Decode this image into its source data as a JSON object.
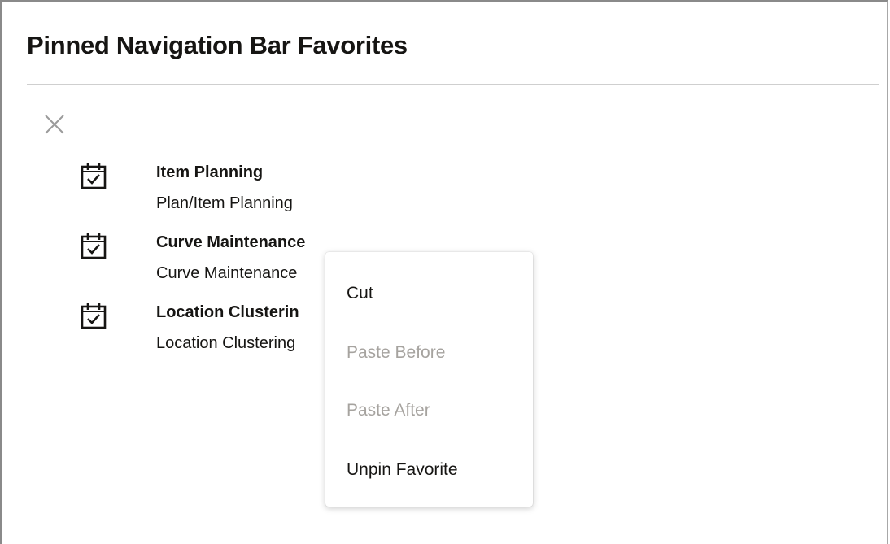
{
  "dialog": {
    "title": "Pinned Navigation Bar Favorites"
  },
  "toolbar": {
    "close_icon": "close-icon"
  },
  "favorites": [
    {
      "name": "Item Planning",
      "path": "Plan/Item Planning",
      "icon": "calendar-check-icon"
    },
    {
      "name": "Curve Maintenance",
      "path": "Curve Maintenance",
      "icon": "calendar-check-icon"
    },
    {
      "name": "Location Clusterin",
      "path": "Location Clustering",
      "icon": "calendar-check-icon"
    }
  ],
  "context_menu": {
    "items": [
      {
        "label": "Cut",
        "enabled": true
      },
      {
        "label": "Paste Before",
        "enabled": false
      },
      {
        "label": "Paste After",
        "enabled": false
      },
      {
        "label": "Unpin Favorite",
        "enabled": true
      }
    ]
  },
  "colors": {
    "text": "#161513",
    "disabled_text": "#a6a39f",
    "divider": "#cfcfcf",
    "icon": "#161513"
  }
}
